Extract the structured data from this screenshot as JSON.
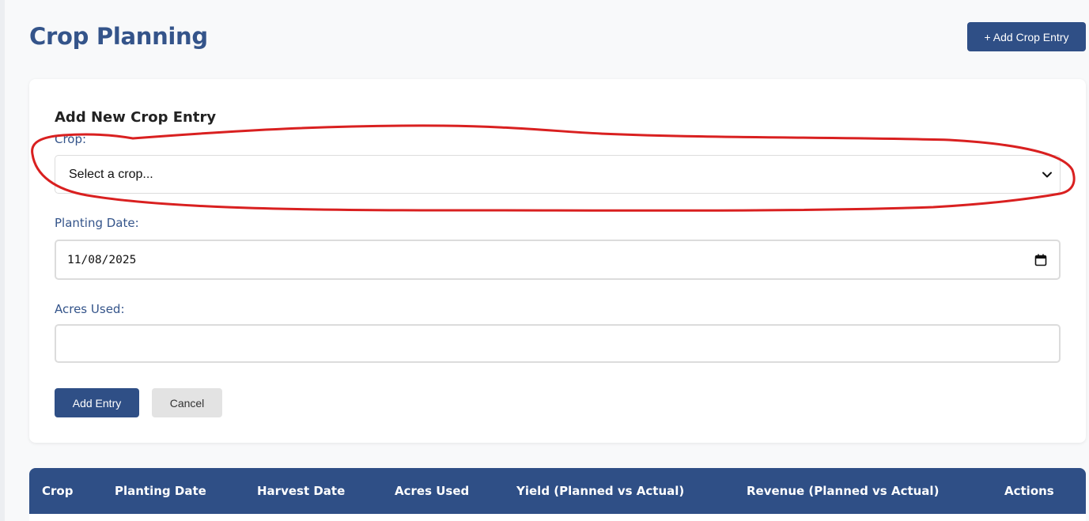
{
  "page": {
    "title": "Crop Planning",
    "add_button_label": "+ Add Crop Entry"
  },
  "form": {
    "title": "Add New Crop Entry",
    "crop": {
      "label": "Crop:",
      "selected": "Select a crop..."
    },
    "planting_date": {
      "label": "Planting Date:",
      "value": "11/08/2025"
    },
    "acres_used": {
      "label": "Acres Used:",
      "value": ""
    },
    "submit_label": "Add Entry",
    "cancel_label": "Cancel"
  },
  "table": {
    "columns": [
      "Crop",
      "Planting Date",
      "Harvest Date",
      "Acres Used",
      "Yield (Planned vs Actual)",
      "Revenue (Planned vs Actual)",
      "Actions"
    ]
  },
  "icons": {
    "select": "chevron-down-icon",
    "date": "calendar-icon"
  },
  "colors": {
    "primary": "#2f4f86",
    "title": "#34548a",
    "annotation": "#d92020"
  }
}
